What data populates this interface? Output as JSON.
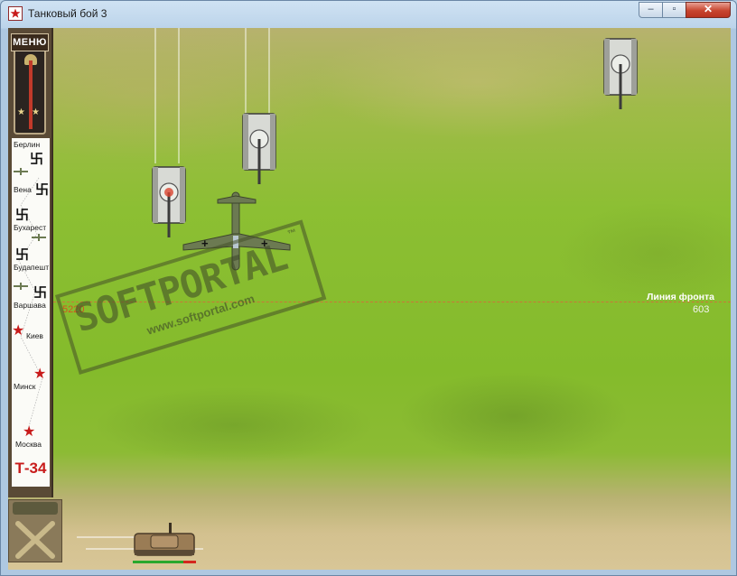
{
  "window": {
    "title": "Танковый бой 3",
    "controls": {
      "minimize": "–",
      "maximize": "▫",
      "close": "✕"
    }
  },
  "sidebar": {
    "menu_label": "МЕНЮ",
    "cities": [
      "Берлин",
      "Вена",
      "Бухарест",
      "Будапешт",
      "Варшава",
      "Киев",
      "Минск",
      "Москва"
    ],
    "tank_model": "Т-34"
  },
  "hud": {
    "front_label": "Линия фронта",
    "front_value": "603",
    "score": "5220"
  },
  "watermark": {
    "logo": "SOFTPORTAL",
    "trademark": "™",
    "url": "www.softportal.com"
  },
  "colors": {
    "soviet_red": "#c81b1b",
    "front_line": "#d66b3a",
    "health_ok": "#29a82d",
    "health_damage": "#d4271e"
  },
  "player": {
    "health_fraction": 0.8
  }
}
